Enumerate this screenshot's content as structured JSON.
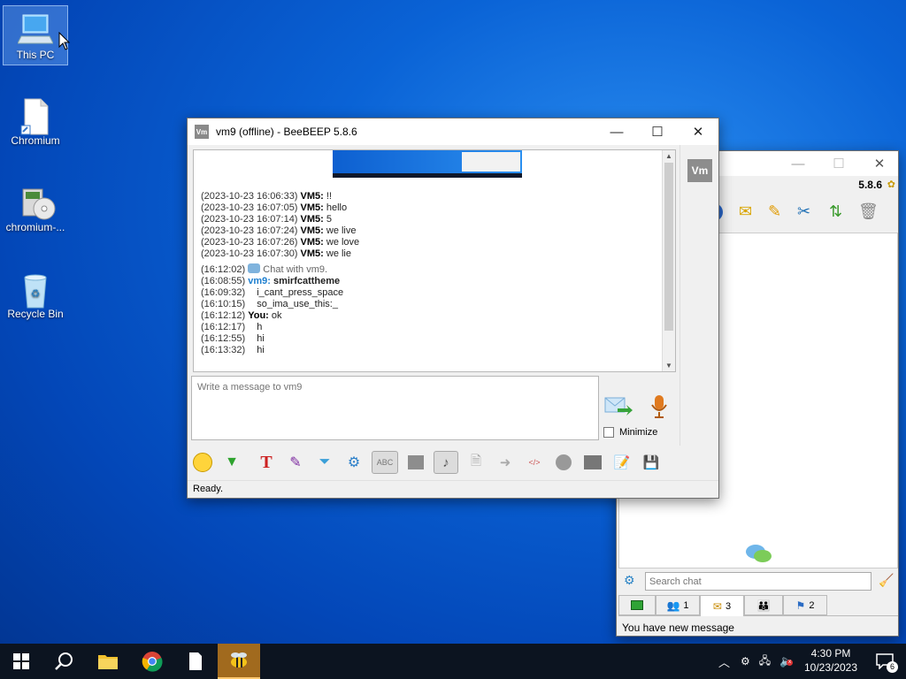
{
  "desktop": {
    "icons": [
      {
        "label": "This PC"
      },
      {
        "label": "Chromium"
      },
      {
        "label": "chromium-..."
      },
      {
        "label": "Recycle Bin"
      }
    ]
  },
  "chat_window": {
    "title": "vm9 (offline) - BeeBEEP 5.8.6",
    "avatar_text": "Vm",
    "messages": [
      {
        "ts": "(2023-10-23 16:06:33)",
        "user": "VM5:",
        "text": "!!"
      },
      {
        "ts": "(2023-10-23 16:07:05)",
        "user": "VM5:",
        "text": "hello"
      },
      {
        "ts": "(2023-10-23 16:07:14)",
        "user": "VM5:",
        "text": "5"
      },
      {
        "ts": "(2023-10-23 16:07:24)",
        "user": "VM5:",
        "text": "we live"
      },
      {
        "ts": "(2023-10-23 16:07:26)",
        "user": "VM5:",
        "text": "we love"
      },
      {
        "ts": "(2023-10-23 16:07:30)",
        "user": "VM5:",
        "text": "we lie"
      }
    ],
    "system_line": {
      "ts": "(16:12:02)",
      "text": "Chat with vm9."
    },
    "recent": [
      {
        "ts": "(16:08:55)",
        "user": "vm9:",
        "text": "smirfcattheme"
      },
      {
        "ts": "(16:09:32)",
        "user": "",
        "text": "i_cant_press_space"
      },
      {
        "ts": "(16:10:15)",
        "user": "",
        "text": "so_ima_use_this:_"
      },
      {
        "ts": "(16:12:12)",
        "user": "You:",
        "text": "ok"
      },
      {
        "ts": "(16:12:17)",
        "user": "",
        "text": "h"
      },
      {
        "ts": "(16:12:55)",
        "user": "",
        "text": "hi"
      },
      {
        "ts": "(16:13:32)",
        "user": "",
        "text": "hi"
      }
    ],
    "input_placeholder": "Write a message to vm9",
    "minimize_label": "Minimize",
    "status": "Ready."
  },
  "main_window": {
    "version": "5.8.6",
    "search_placeholder": "Search chat",
    "tabs": [
      {
        "count": ""
      },
      {
        "count": "1"
      },
      {
        "count": "3"
      },
      {
        "count": ""
      },
      {
        "count": "2"
      }
    ],
    "status": "You have new message"
  },
  "taskbar": {
    "time": "4:30 PM",
    "date": "10/23/2023",
    "notification_count": "6"
  },
  "colors": {
    "vm9_name": "#1e7fcf",
    "taskbar_bg": "#0c1420"
  }
}
